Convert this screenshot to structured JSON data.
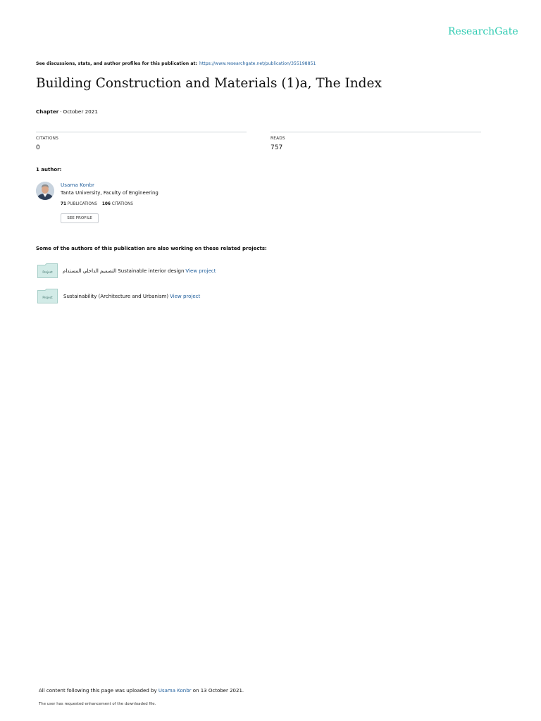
{
  "brand": {
    "name": "ResearchGate",
    "color": "#2fcbb2"
  },
  "discussion_line": {
    "text": "See discussions, stats, and author profiles for this publication at:",
    "url": "https://www.researchgate.net/publication/355198851"
  },
  "publication": {
    "title": "Building Construction and Materials (1)a, The Index",
    "type": "Chapter",
    "separator": "·",
    "date": "October 2021"
  },
  "stats": {
    "citations": {
      "label": "CITATIONS",
      "value": "0"
    },
    "reads": {
      "label": "READS",
      "value": "757"
    }
  },
  "authors": {
    "heading": "1 author:",
    "items": [
      {
        "name": "Usama Konbr",
        "affiliation": "Tanta University, Faculty of Engineering",
        "publications_count": "71",
        "publications_label": "PUBLICATIONS",
        "citations_count": "106",
        "citations_label": "CITATIONS",
        "see_profile_label": "SEE PROFILE"
      }
    ]
  },
  "projects": {
    "heading": "Some of the authors of this publication are also working on these related projects:",
    "icon_label": "Project",
    "link_label": "View project",
    "items": [
      {
        "text": "التصميم الداخلي المستدام Sustainable interior design"
      },
      {
        "text": "Sustainability (Architecture and Urbanism)"
      }
    ]
  },
  "footer": {
    "uploaded_prefix": "All content following this page was uploaded by",
    "uploader": "Usama Konbr",
    "uploaded_suffix": "on 13 October 2021.",
    "note": "The user has requested enhancement of the downloaded file."
  },
  "colors": {
    "link": "#1d5c9a",
    "rule": "#cfd4d8",
    "project_icon": "#cfe7e4"
  }
}
